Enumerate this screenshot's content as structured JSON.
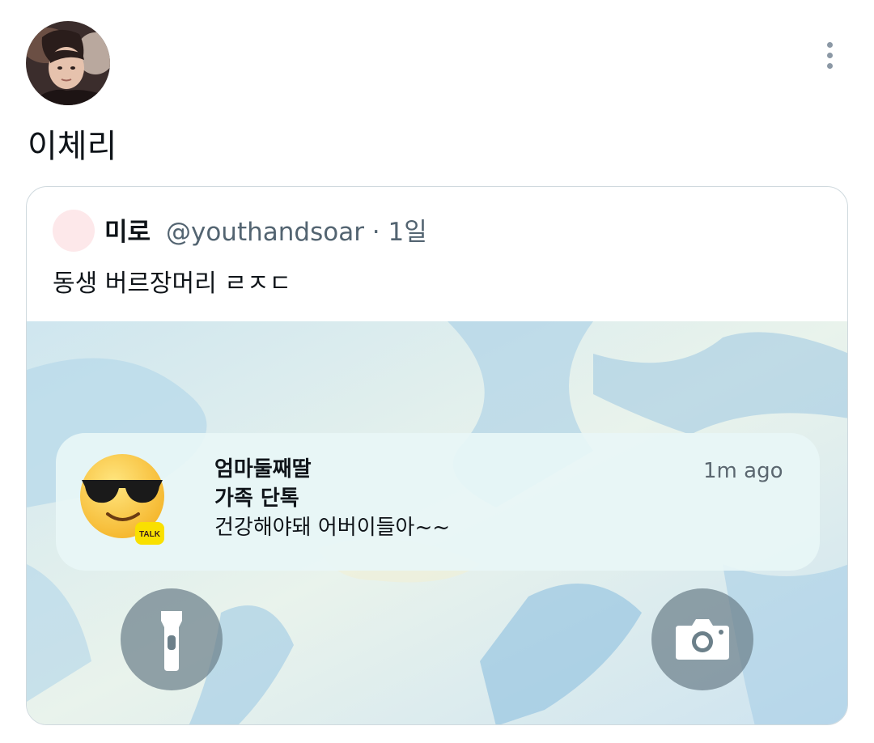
{
  "post": {
    "title": "이체리",
    "more_icon": "more-vertical-icon"
  },
  "quoted": {
    "name": "미로",
    "handle_and_time": "@youthandsoar · 1일",
    "text": "동생 버르장머리 ㄹㅈㄷ"
  },
  "notification": {
    "sender": "엄마둘째딸",
    "group": "가족 단톡",
    "message": "건강해야돼 어버이들아~~",
    "time": "1m ago",
    "app_badge": "TALK",
    "emoji_icon": "sunglasses-emoji-icon"
  },
  "lockscreen": {
    "flashlight_icon": "flashlight-icon",
    "camera_icon": "camera-icon"
  },
  "colors": {
    "text_primary": "#0f1419",
    "text_secondary": "#536471",
    "card_border": "#cfd9de",
    "kakao_yellow": "#f9e000"
  }
}
